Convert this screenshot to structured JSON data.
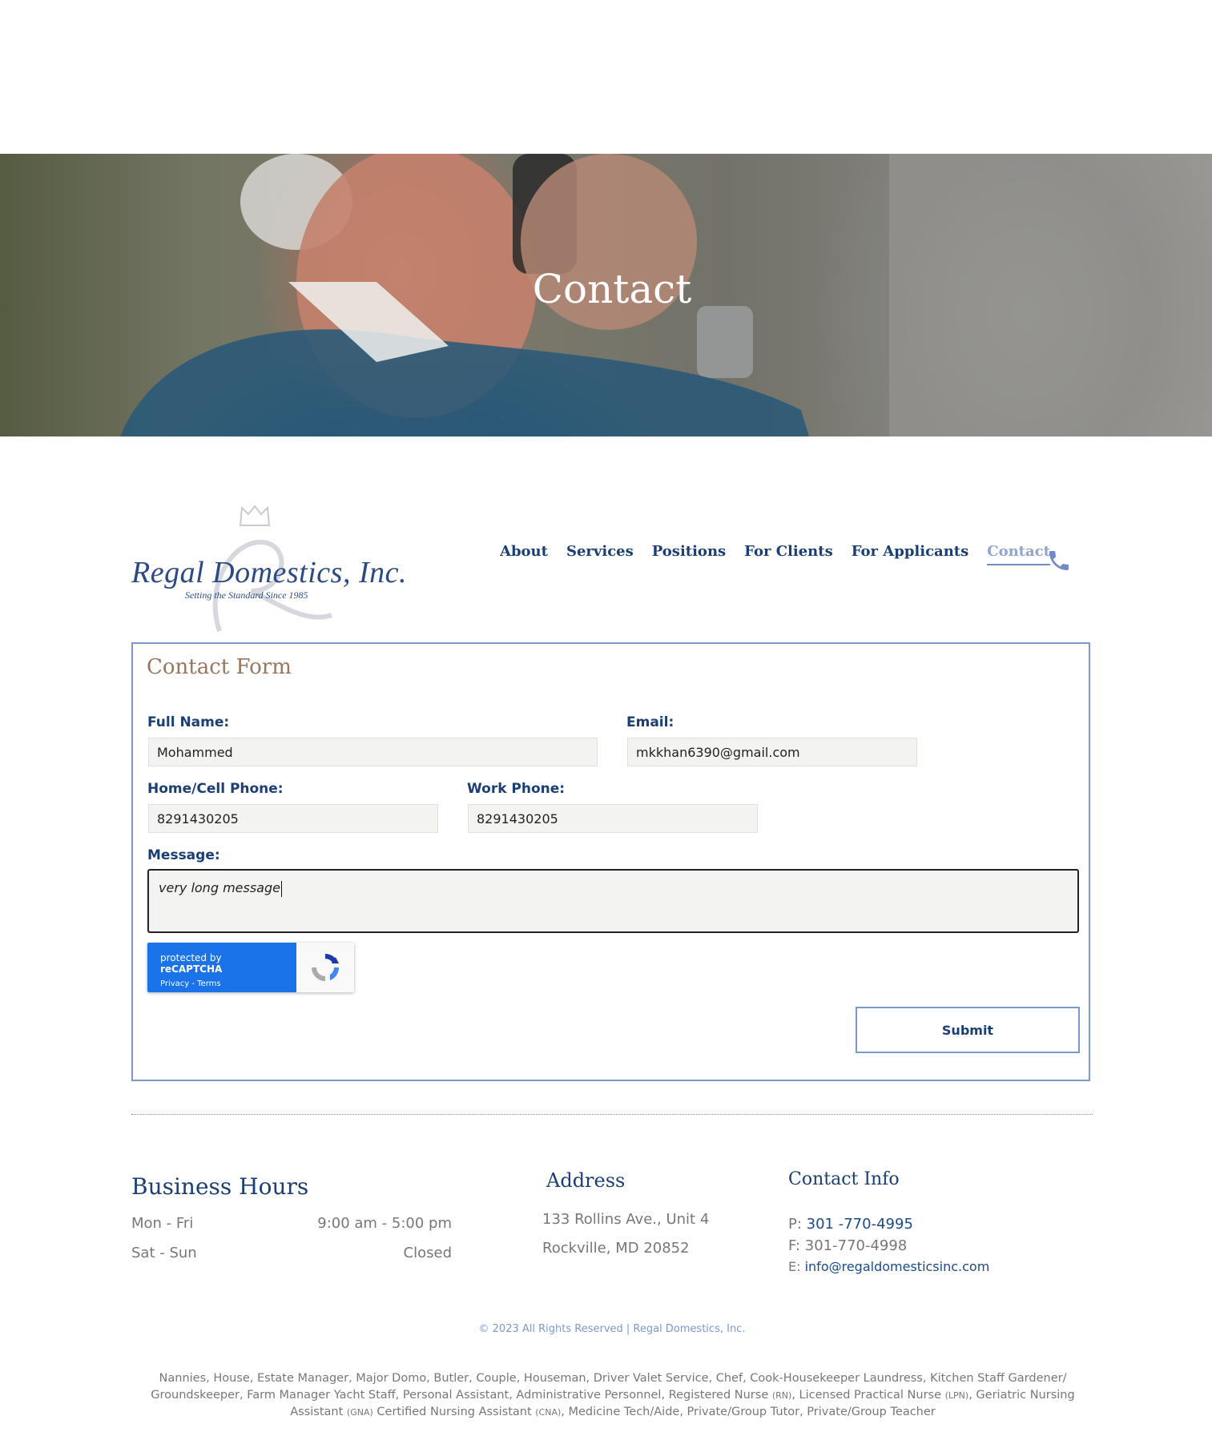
{
  "hero": {
    "title": "Contact"
  },
  "logo": {
    "name": "Regal Domestics, Inc.",
    "tagline": "Setting the Standard Since 1985"
  },
  "nav": {
    "items": [
      "About",
      "Services",
      "Positions",
      "For Clients",
      "For Applicants",
      "Contact"
    ],
    "active": "Contact",
    "phone_icon": "phone-icon"
  },
  "form": {
    "title": "Contact Form",
    "full_name_label": "Full Name:",
    "full_name_value": "Mohammed",
    "email_label": "Email:",
    "email_value": "mkkhan6390@gmail.com",
    "home_phone_label": "Home/Cell Phone:",
    "home_phone_value": "8291430205",
    "work_phone_label": "Work Phone:",
    "work_phone_value": "8291430205",
    "message_label": "Message:",
    "message_value": "very long message",
    "recaptcha_prefix": "protected by",
    "recaptcha_brand": "reCAPTCHA",
    "recaptcha_links": "Privacy - Terms",
    "submit_label": "Submit"
  },
  "footer": {
    "hours_title": "Business Hours",
    "hours": [
      {
        "days": "Mon - Fri",
        "time": "9:00 am - 5:00 pm"
      },
      {
        "days": "Sat - Sun",
        "time": "Closed"
      }
    ],
    "address_title": "Address",
    "address_line1": "133 Rollins Ave., Unit 4",
    "address_line2": "Rockville, MD 20852",
    "contact_title": "Contact Info",
    "phone_prefix": "P:",
    "phone": "301 -770-4995",
    "fax_prefix": "F:",
    "fax": "301-770-4998",
    "email_prefix": "E:",
    "email": "info@regaldomesticsinc.com",
    "copyright": "© 2023 All Rights Reserved | Regal Domestics, Inc.",
    "positions_part1": "Nannies, House, Estate Manager, Major Domo, Butler, Couple, Houseman, Driver Valet Service, Chef, Cook-Housekeeper Laundress, Kitchen Staff Gardener/ Groundskeeper, Farm Manager Yacht Staff, Personal Assistant, Administrative Personnel, Registered Nurse ",
    "positions_rn": "(RN)",
    "positions_part2": ", Licensed Practical Nurse ",
    "positions_lpn": "(LPN)",
    "positions_part3": ", Geriatric Nursing Assistant ",
    "positions_gna": "(GNA)",
    "positions_part4": " Certified Nursing Assistant ",
    "positions_cna": "(CNA)",
    "positions_part5": ", Medicine Tech/Aide, Private/Group Tutor, Private/Group Teacher"
  }
}
